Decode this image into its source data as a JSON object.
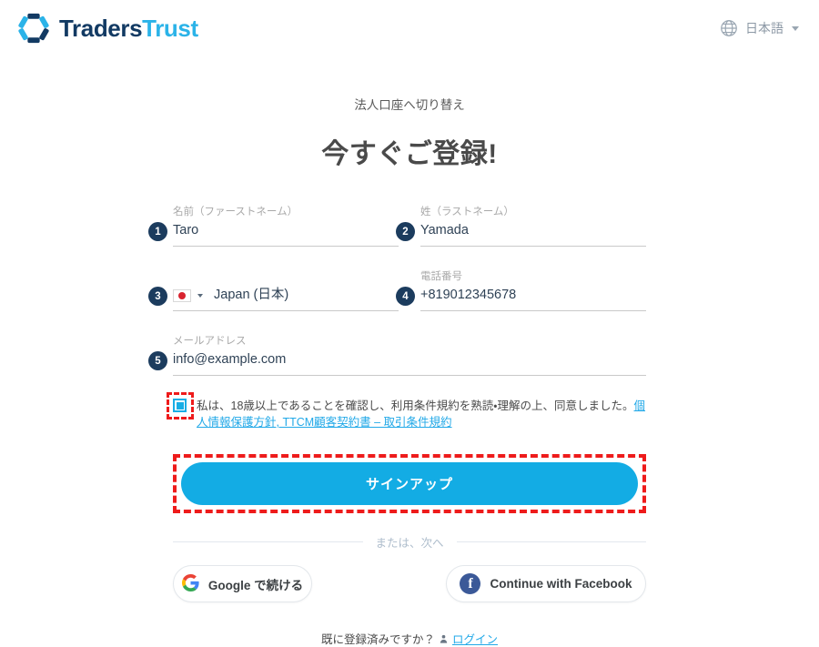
{
  "header": {
    "brand_first": "Traders",
    "brand_second": "Trust",
    "logo_icon": "hexagon-segments-logo",
    "language": {
      "icon": "globe-icon",
      "label": "日本語",
      "caret_icon": "chevron-down-icon"
    }
  },
  "page": {
    "switch_link": "法人口座へ切り替え",
    "title": "今すぐご登録!"
  },
  "form": {
    "fields": [
      {
        "badge": "1",
        "name": "first-name",
        "label": "名前（ファーストネーム）",
        "value": "Taro",
        "placeholder": "名前（ファーストネーム）"
      },
      {
        "badge": "2",
        "name": "last-name",
        "label": "姓（ラストネーム）",
        "value": "Yamada",
        "placeholder": "姓（ラストネーム）"
      },
      {
        "badge": "3",
        "name": "country",
        "label": "",
        "value": "Japan (日本)",
        "flag_icon": "japan-flag-icon",
        "caret_icon": "chevron-down-icon"
      },
      {
        "badge": "4",
        "name": "phone",
        "label": "電話番号",
        "value": "+819012345678",
        "placeholder": "電話番号"
      },
      {
        "badge": "5",
        "name": "email",
        "label": "メールアドレス",
        "value": "info@example.com",
        "placeholder": "メールアドレス"
      }
    ],
    "consent": {
      "checked": true,
      "text_before": "私は、18歳以上であることを確認し、利用条件規約を熟読・理解の上、同意しました。",
      "link_text": "個人情報保護方針, TTCM顧客契約書 – 取引条件規約"
    },
    "signup_button": "サインアップ"
  },
  "divider_text": "または、次へ",
  "social": {
    "google": {
      "icon": "google-g-icon",
      "label": "Google で続ける"
    },
    "facebook": {
      "icon": "facebook-f-icon",
      "label": "Continue with Facebook"
    }
  },
  "footer": {
    "question": "既に登録済みですか？",
    "icon": "person-icon",
    "login_link": "ログイン"
  },
  "colors": {
    "brand_dark": "#123a63",
    "brand_light": "#2bb3e8",
    "accent_button": "#13ace4",
    "badge_bg": "#1c3c5e",
    "link": "#22a9e8",
    "annotation": "#ee1b1b"
  }
}
